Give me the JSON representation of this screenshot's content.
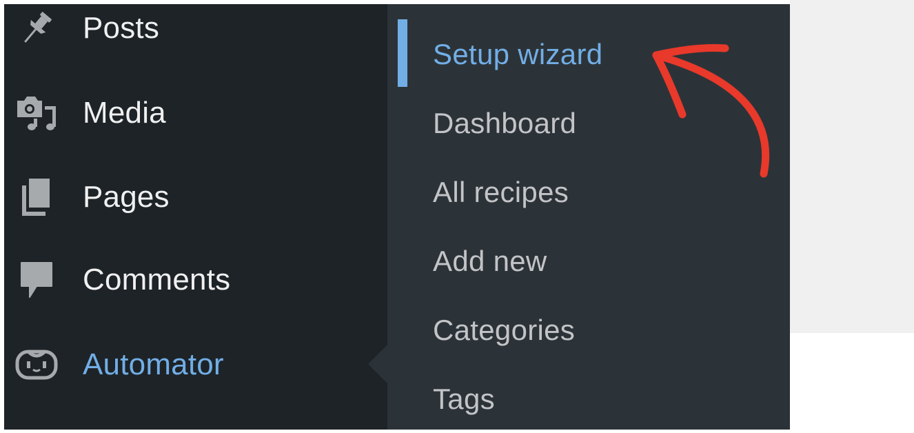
{
  "admin_menu": {
    "items": [
      {
        "label": "Posts",
        "icon": "pin-icon"
      },
      {
        "label": "Media",
        "icon": "media-icon"
      },
      {
        "label": "Pages",
        "icon": "pages-icon"
      },
      {
        "label": "Comments",
        "icon": "comment-icon"
      },
      {
        "label": "Automator",
        "icon": "robot-icon",
        "current": true
      }
    ]
  },
  "submenu": {
    "items": [
      {
        "label": "Setup wizard",
        "current": true
      },
      {
        "label": "Dashboard"
      },
      {
        "label": "All recipes"
      },
      {
        "label": "Add new"
      },
      {
        "label": "Categories"
      },
      {
        "label": "Tags"
      }
    ]
  },
  "colors": {
    "menu_background": "#1d2327",
    "submenu_background": "#2c3338",
    "active_text": "#72aee6",
    "menu_text": "#f0f0f1",
    "submenu_text": "#c3c4c7",
    "annotation_arrow": "#e8392b"
  }
}
